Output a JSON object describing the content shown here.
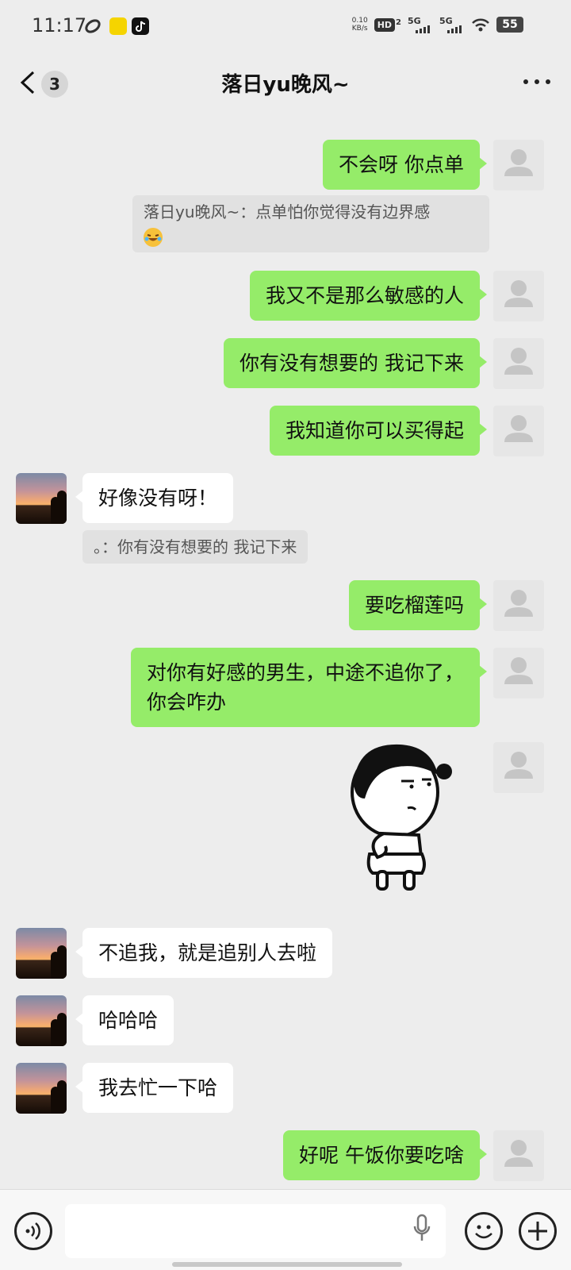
{
  "status_bar": {
    "time": "11:17",
    "net_speed_top": "0.10",
    "net_speed_bottom": "KB/s",
    "hd": "HD",
    "hd_sub": "2",
    "sig1": "5G",
    "sig2": "5G",
    "battery": "55",
    "app_icons": [
      "meituan-icon",
      "douyin-icon",
      "hollow-icon"
    ]
  },
  "header": {
    "unread_count": "3",
    "title": "落日yu晚风~"
  },
  "messages": [
    {
      "side": "me",
      "text": "不会呀 你点单"
    },
    {
      "quote": "落日yu晚风~：点单怕你觉得没有边界感"
    },
    {
      "side": "me",
      "text": "我又不是那么敏感的人"
    },
    {
      "side": "me",
      "text": "你有没有想要的 我记下来"
    },
    {
      "side": "me",
      "text": "我知道你可以买得起"
    },
    {
      "side": "them",
      "text": "好像没有呀！"
    },
    {
      "quote": "。：你有没有想要的 我记下来"
    },
    {
      "side": "me",
      "text": "要吃榴莲吗"
    },
    {
      "side": "me",
      "line1": "对你有好感的男生，中途不追你了，",
      "line2": "你会咋办"
    },
    {
      "side": "me",
      "type": "sticker"
    },
    {
      "side": "them",
      "text": "不追我，就是追别人去啦"
    },
    {
      "side": "them",
      "text": "哈哈哈"
    },
    {
      "side": "them",
      "text": "我去忙一下哈"
    },
    {
      "side": "me",
      "text": "好呢 午饭你要吃啥"
    }
  ],
  "input": {
    "value": ""
  },
  "colors": {
    "background": "#ededed",
    "my_bubble": "#95ec69",
    "their_bubble": "#ffffff"
  }
}
